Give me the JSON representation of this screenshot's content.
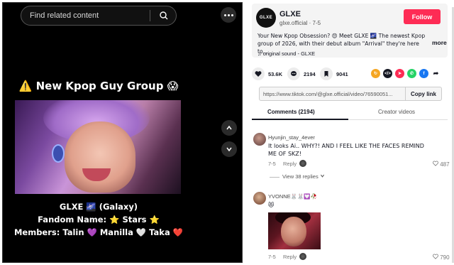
{
  "search": {
    "placeholder": "Find related content"
  },
  "video": {
    "title": "⚠️ New Kpop Guy Group 😱",
    "caption_line1": "GLXE 🌌 (Galaxy)",
    "caption_line2": "Fandom Name: ⭐ Stars ⭐",
    "caption_line3": "Members: Talin 💜 Manilla 🤍 Taka ❤️"
  },
  "profile": {
    "avatar_text": "GLXE",
    "name": "GLXE",
    "handle_date": "glxe.official · 7-5",
    "follow_label": "Follow",
    "description": "Your New Kpop Obsession? 😍 Meet GLXE 🌌 The newest Kpop group of 2026, with their debut album \"Arrival\" they're here to...",
    "more_label": "more",
    "sound": "♫  original sound - GLXE"
  },
  "stats": {
    "likes": "53.6K",
    "comments": "2194",
    "saves": "9041"
  },
  "share": {
    "link": "https://www.tiktok.com/@glxe.official/video/76590051...",
    "copy_label": "Copy link",
    "colors": [
      "#f5a623",
      "#161823",
      "#fe2c55",
      "#25d366",
      "#1877f2"
    ]
  },
  "tabs": {
    "comments": "Comments (2194)",
    "creator": "Creator videos"
  },
  "comments": [
    {
      "user": "Hyunjin_stay_4ever",
      "text": "It looks Ai.. WHY?! AND I FEEL LIKE THE FACES REMIND ME OF SKZ!",
      "date": "7-5",
      "reply_label": "Reply",
      "likes": "487",
      "view_replies": "View 38 replies"
    },
    {
      "user": "YVONNE🐰🐰💟🥀",
      "text": "😻",
      "date": "7-5",
      "reply_label": "Reply",
      "likes": "790"
    }
  ]
}
